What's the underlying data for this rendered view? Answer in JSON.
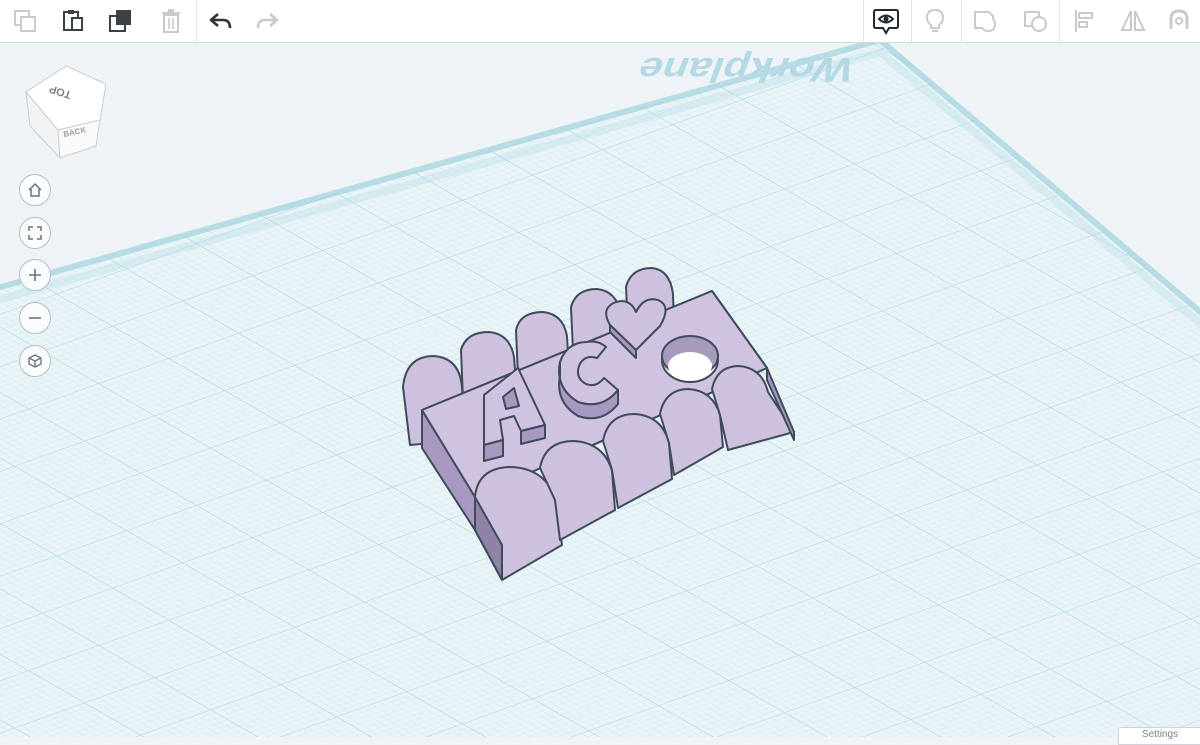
{
  "toolbar": {
    "left_tools": [
      {
        "name": "copy-button",
        "icon": "copy-icon",
        "enabled": false
      },
      {
        "name": "paste-button",
        "icon": "paste-icon",
        "enabled": true
      },
      {
        "name": "duplicate-button",
        "icon": "duplicate-icon",
        "enabled": true
      },
      {
        "name": "delete-button",
        "icon": "trash-icon",
        "enabled": false
      },
      {
        "name": "undo-button",
        "icon": "undo-icon",
        "enabled": true
      },
      {
        "name": "redo-button",
        "icon": "redo-icon",
        "enabled": false
      }
    ],
    "right_tools": [
      {
        "name": "show-all-button",
        "icon": "eye-speech-icon",
        "enabled": true
      },
      {
        "name": "light-button",
        "icon": "lightbulb-icon",
        "enabled": false
      },
      {
        "name": "group-button",
        "icon": "group-icon",
        "enabled": false
      },
      {
        "name": "ungroup-button",
        "icon": "ungroup-icon",
        "enabled": false
      },
      {
        "name": "align-button",
        "icon": "align-icon",
        "enabled": false
      },
      {
        "name": "mirror-button",
        "icon": "mirror-icon",
        "enabled": false
      },
      {
        "name": "magnet-button",
        "icon": "magnet-icon",
        "enabled": false
      }
    ]
  },
  "viewcube": {
    "top_label": "TOP",
    "back_label": "BACK"
  },
  "nav_controls": [
    {
      "name": "home-view-button",
      "icon": "home-icon"
    },
    {
      "name": "fit-view-button",
      "icon": "fit-icon"
    },
    {
      "name": "zoom-in-button",
      "icon": "plus-icon"
    },
    {
      "name": "zoom-out-button",
      "icon": "minus-icon"
    },
    {
      "name": "ortho-view-button",
      "icon": "cube-icon"
    }
  ],
  "workplane": {
    "label": "Workplane"
  },
  "model": {
    "letters": "AC",
    "shape_color": "#cfc3e0"
  },
  "footer": {
    "settings_label": "Settings"
  },
  "colors": {
    "grid_bg": "#e9f4f7",
    "grid_line": "#b9dde6",
    "model_fill": "#cfc3e0",
    "model_stroke": "#3f4a5c"
  }
}
